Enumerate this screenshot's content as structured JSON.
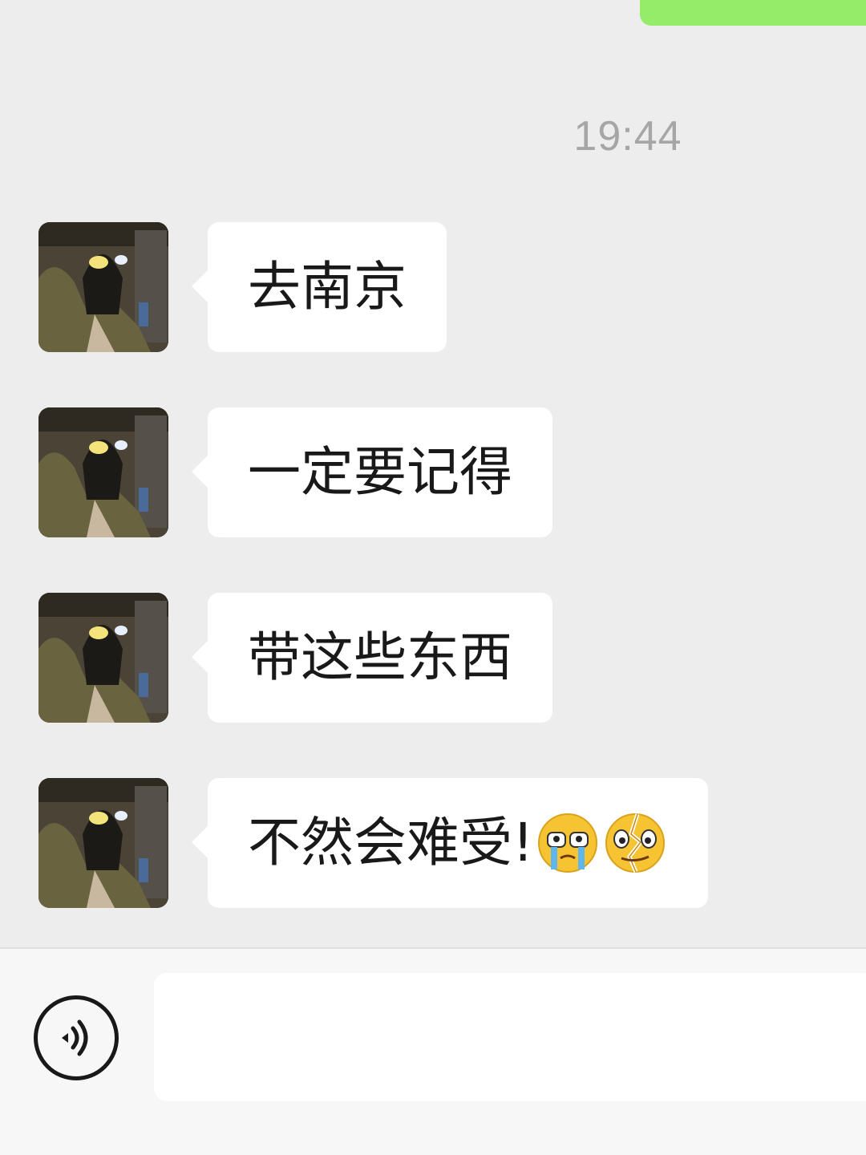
{
  "chat": {
    "timestamp": "19:44",
    "messages": [
      {
        "sender": "contact",
        "text": "去南京",
        "emojis": []
      },
      {
        "sender": "contact",
        "text": "一定要记得",
        "emojis": []
      },
      {
        "sender": "contact",
        "text": "带这些东西",
        "emojis": []
      },
      {
        "sender": "contact",
        "text": "不然会难受!",
        "emojis": [
          "crying-face-emoji",
          "broken-face-emoji"
        ]
      }
    ]
  },
  "input_bar": {
    "voice_icon": "voice-input-icon",
    "text_value": "",
    "placeholder": ""
  },
  "colors": {
    "background": "#ededed",
    "received_bubble": "#ffffff",
    "sent_bubble": "#95ec69",
    "timestamp": "#a6a6a6"
  }
}
